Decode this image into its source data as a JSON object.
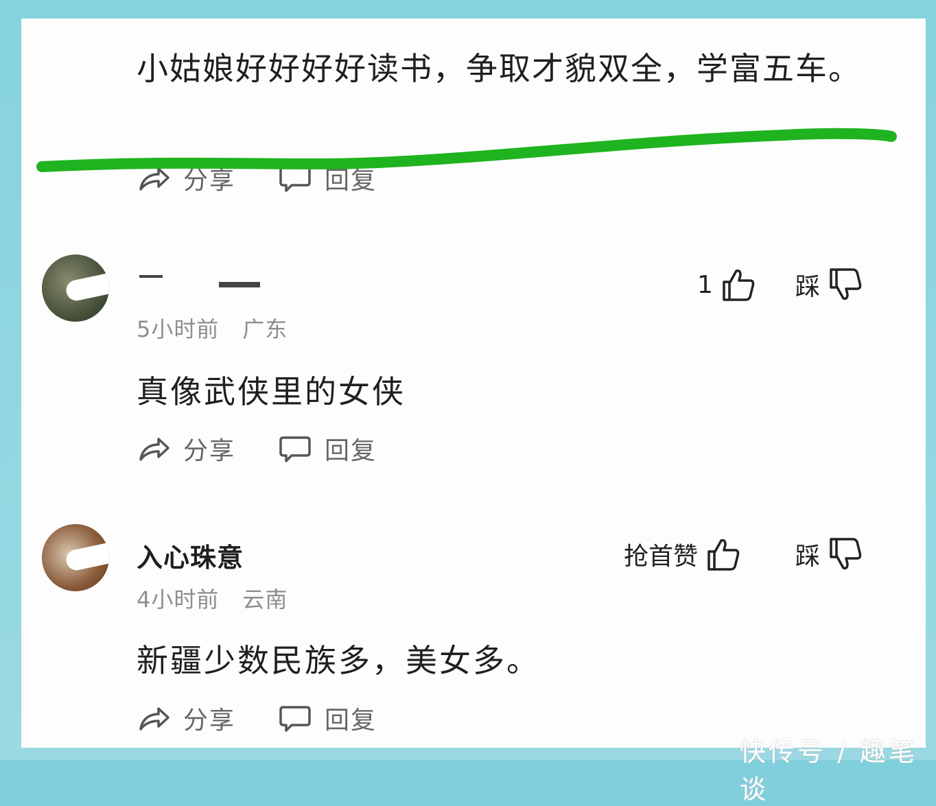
{
  "top_comment": {
    "text": "小姑娘好好好好读书，争取才貌双全，学富五车。",
    "actions": {
      "share": "分享",
      "reply": "回复"
    }
  },
  "comments": [
    {
      "username": "",
      "time": "5小时前",
      "location": "广东",
      "text": "真像武侠里的女侠",
      "like_count": "1",
      "dislike_label": "踩",
      "actions": {
        "share": "分享",
        "reply": "回复"
      }
    },
    {
      "username": "入心珠意",
      "time": "4小时前",
      "location": "云南",
      "text": "新疆少数民族多，美女多。",
      "like_label": "抢首赞",
      "dislike_label": "踩",
      "actions": {
        "share": "分享",
        "reply": "回复"
      }
    }
  ],
  "watermark": "快传号 / 趣笔谈",
  "colors": {
    "frame": "#86d3de",
    "card": "#fdfdfd",
    "highlight_line": "#1fb31f",
    "text": "#1f1f1f",
    "muted": "#8e8e8e"
  },
  "icons": {
    "share": "share-arrow-icon",
    "reply": "speech-bubble-icon",
    "like": "thumbs-up-icon",
    "dislike": "thumbs-down-icon"
  }
}
